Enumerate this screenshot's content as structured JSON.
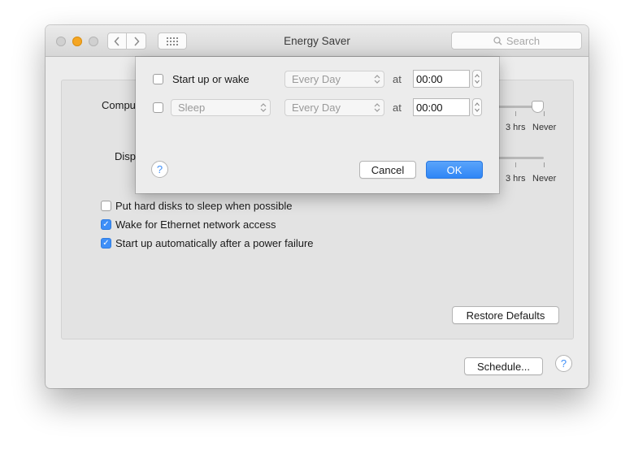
{
  "window": {
    "title": "Energy Saver"
  },
  "toolbar": {
    "search_placeholder": "Search"
  },
  "settings": {
    "computer_label": "Compu",
    "display_label": "Disp",
    "slider_labels": {
      "three_hrs": "3 hrs",
      "never": "Never"
    },
    "checkboxes": [
      {
        "label": "Put hard disks to sleep when possible",
        "checked": false
      },
      {
        "label": "Wake for Ethernet network access",
        "checked": true
      },
      {
        "label": "Start up automatically after a power failure",
        "checked": true
      }
    ],
    "restore_defaults": "Restore Defaults",
    "schedule": "Schedule...",
    "help": "?"
  },
  "sheet": {
    "rows": [
      {
        "event": "Start up or wake",
        "checked": false,
        "frequency": "Every Day",
        "at": "at",
        "time": "00:00"
      },
      {
        "event": "Sleep",
        "checked": false,
        "frequency": "Every Day",
        "at": "at",
        "time": "00:00"
      }
    ],
    "help": "?",
    "cancel": "Cancel",
    "ok": "OK"
  },
  "colors": {
    "accent": "#3f8ff7",
    "minimize": "#f5a623"
  },
  "icons": [
    "back-icon",
    "forward-icon",
    "show-all-grid-icon",
    "search-icon",
    "checkmark-icon",
    "updown-arrows-icon"
  ]
}
